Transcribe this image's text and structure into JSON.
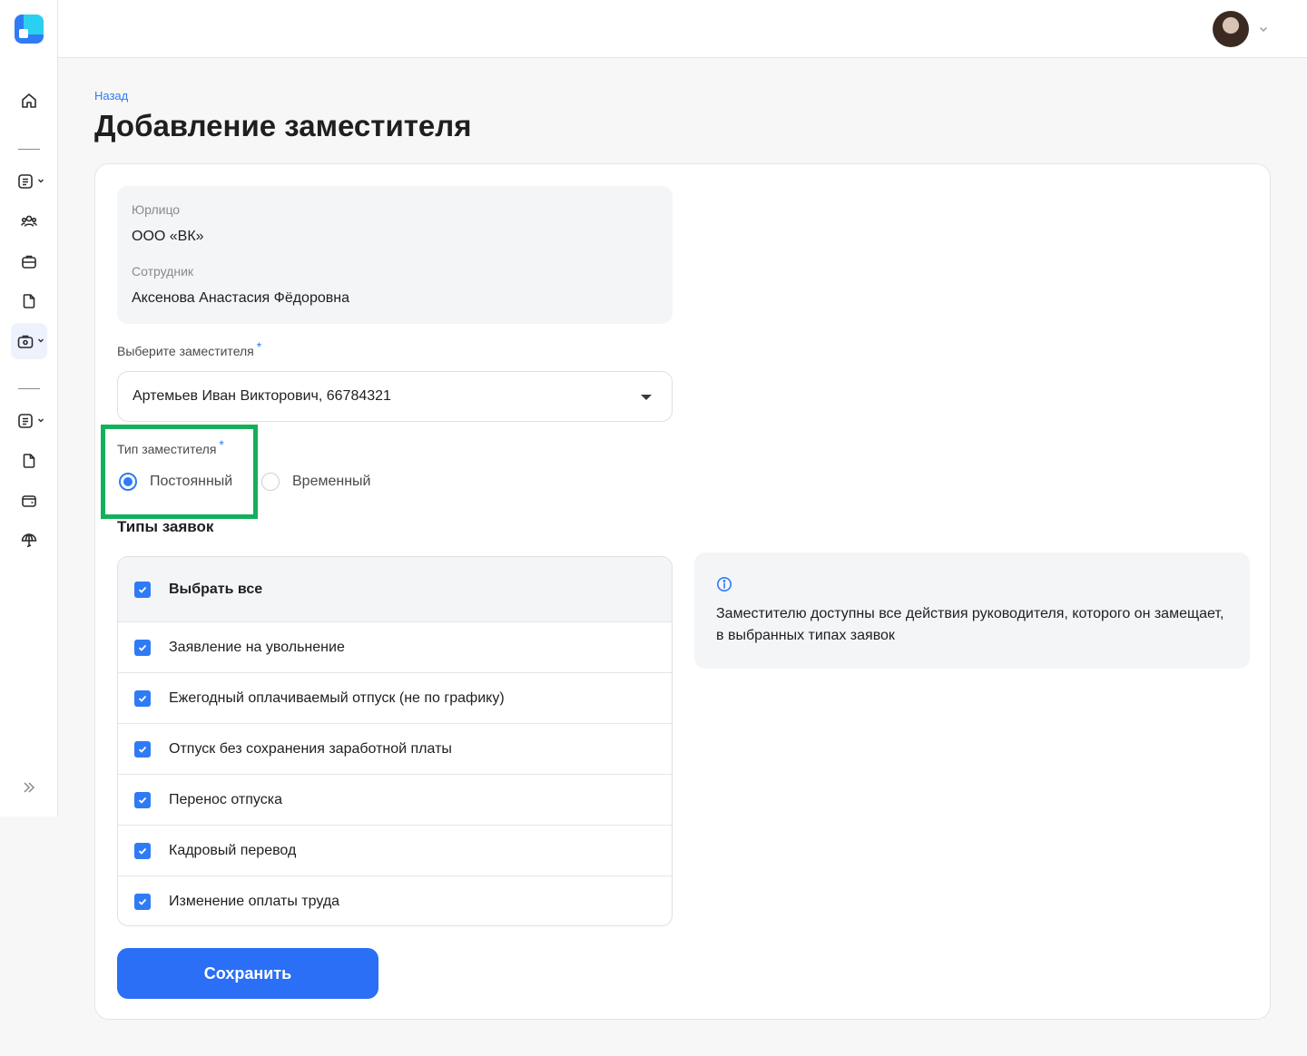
{
  "sidebar": {
    "icons": [
      "home-icon",
      "document-list-icon",
      "people-icon",
      "briefcase-icon",
      "file-icon",
      "case-settings-icon",
      "document-list-icon",
      "file-icon",
      "wallet-icon",
      "umbrella-icon",
      "expand-icon"
    ]
  },
  "header": {
    "avatar": "user-avatar"
  },
  "main": {
    "back_label": "Назад",
    "title": "Добавление заместителя"
  },
  "info": {
    "entity_label": "Юрлицо",
    "entity_value": "ООО «ВК»",
    "employee_label": "Сотрудник",
    "employee_value": "Аксенова Анастасия Фёдоровна"
  },
  "deputy_select": {
    "label": "Выберите заместителя",
    "required_mark": "*",
    "value": "Артемьев Иван Викторович, 66784321"
  },
  "deputy_type": {
    "label": "Тип заместителя",
    "required_mark": "*",
    "options": [
      {
        "label": "Постоянный",
        "checked": true
      },
      {
        "label": "Временный",
        "checked": false
      }
    ]
  },
  "request_types": {
    "title": "Типы заявок",
    "select_all": "Выбрать все",
    "items": [
      "Заявление на увольнение",
      "Ежегодный оплачиваемый отпуск (не по графику)",
      "Отпуск без сохранения заработной платы",
      "Перенос отпуска",
      "Кадровый перевод",
      "Изменение оплаты труда"
    ]
  },
  "notice": {
    "text": "Заместителю доступны все действия руководителя, которого он замещает, в выбранных типах заявок"
  },
  "actions": {
    "save_label": "Сохранить"
  },
  "colors": {
    "accent": "#2f7bf5",
    "highlight": "#13b05c"
  }
}
